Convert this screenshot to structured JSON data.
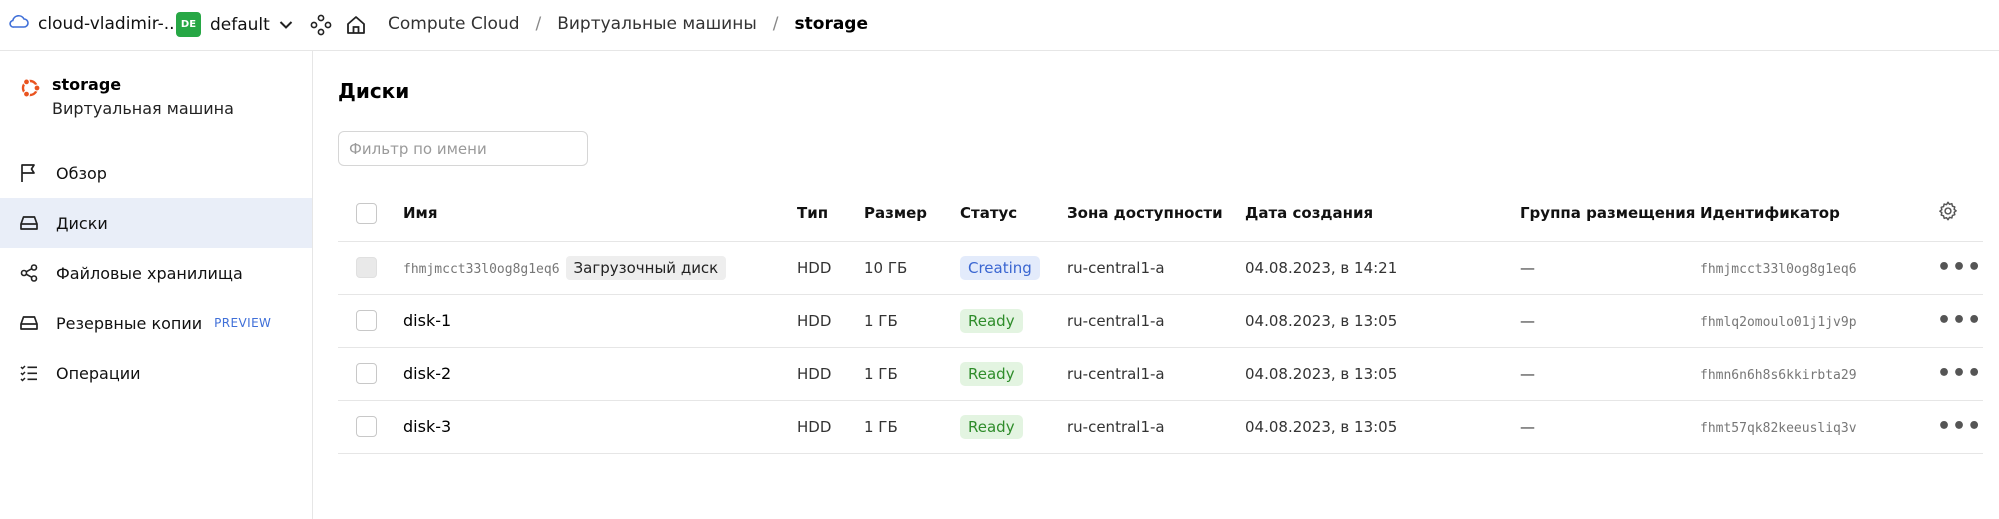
{
  "header": {
    "cloud_name": "cloud-vladimir-...",
    "folder_badge": "DE",
    "folder_name": "default",
    "breadcrumbs": [
      "Compute Cloud",
      "Виртуальные машины",
      "storage"
    ],
    "breadcrumb_separator": "/"
  },
  "sidebar": {
    "vm_title": "storage",
    "vm_subtitle": "Виртуальная машина",
    "items": [
      {
        "label": "Обзор",
        "icon": "flag-icon"
      },
      {
        "label": "Диски",
        "icon": "disk-icon",
        "active": true
      },
      {
        "label": "Файловые хранилища",
        "icon": "share-nodes-icon"
      },
      {
        "label": "Резервные копии",
        "icon": "backup-icon",
        "badge": "PREVIEW"
      },
      {
        "label": "Операции",
        "icon": "checklist-icon"
      }
    ]
  },
  "main": {
    "title": "Диски",
    "filter_placeholder": "Фильтр по имени",
    "columns": [
      "Имя",
      "Тип",
      "Размер",
      "Статус",
      "Зона доступности",
      "Дата создания",
      "Группа размещения",
      "Идентификатор"
    ],
    "rows": [
      {
        "name": "fhmjmcct33l0og8g1eq6",
        "tag": "Загрузочный диск",
        "type": "HDD",
        "size": "10 ГБ",
        "status": "Creating",
        "zone": "ru-central1-a",
        "created": "04.08.2023, в 14:21",
        "group": "—",
        "id": "fhmjmcct33l0og8g1eq6"
      },
      {
        "name": "disk-1",
        "type": "HDD",
        "size": "1 ГБ",
        "status": "Ready",
        "zone": "ru-central1-a",
        "created": "04.08.2023, в 13:05",
        "group": "—",
        "id": "fhmlq2omoulo01j1jv9p"
      },
      {
        "name": "disk-2",
        "type": "HDD",
        "size": "1 ГБ",
        "status": "Ready",
        "zone": "ru-central1-a",
        "created": "04.08.2023, в 13:05",
        "group": "—",
        "id": "fhmn6n6h8s6kkirbta29"
      },
      {
        "name": "disk-3",
        "type": "HDD",
        "size": "1 ГБ",
        "status": "Ready",
        "zone": "ru-central1-a",
        "created": "04.08.2023, в 13:05",
        "group": "—",
        "id": "fhmt57qk82keeusliq3v"
      }
    ],
    "row_actions_label": "•••"
  },
  "colors": {
    "accent": "#3a66d1",
    "ready": "#2e8c2a",
    "folder_badge": "#27a745",
    "active_nav": "#e9eef8"
  }
}
